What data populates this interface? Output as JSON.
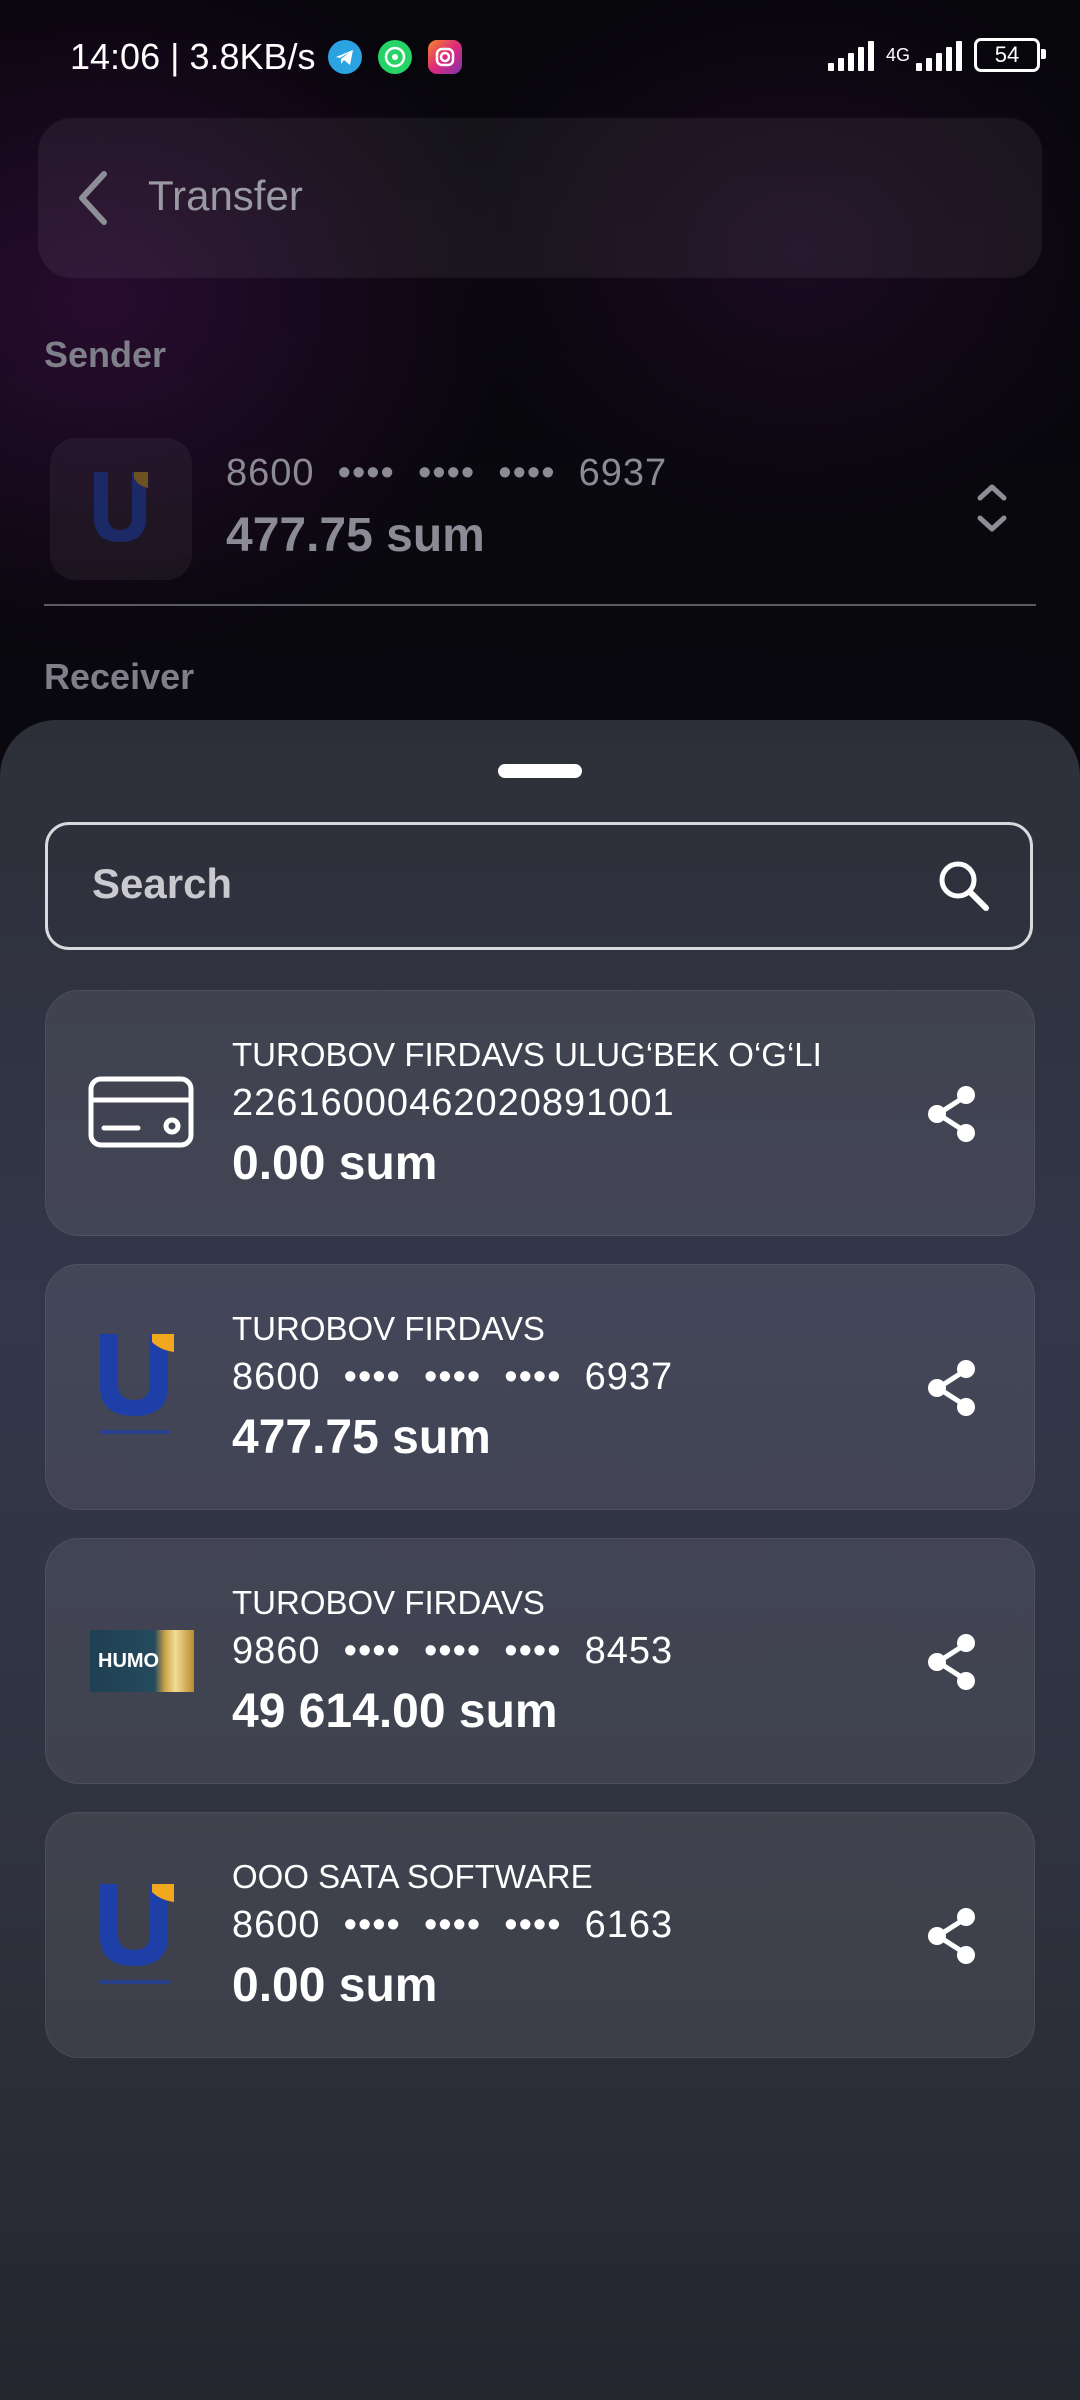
{
  "status_bar": {
    "time": "14:06 | 3.8KB/s",
    "network": "4G",
    "battery": "54"
  },
  "header": {
    "title": "Transfer"
  },
  "sender": {
    "label": "Sender",
    "card_number": "8600  ••••  ••••  ••••  6937",
    "balance": "477.75 sum"
  },
  "receiver": {
    "label": "Receiver"
  },
  "search": {
    "placeholder": "Search"
  },
  "cards": [
    {
      "name": "TUROBOV FIRDAVS ULUG‘BEK O‘G‘LI",
      "number": "22616000462020891001",
      "balance": "0.00 sum",
      "logo": "card-icon"
    },
    {
      "name": "TUROBOV FIRDAVS",
      "number": "8600  ••••  ••••  ••••  6937",
      "balance": "477.75 sum",
      "logo": "uzcard-logo"
    },
    {
      "name": "TUROBOV FIRDAVS",
      "number": "9860  ••••  ••••  ••••  8453",
      "balance": "49 614.00 sum",
      "logo": "humo-logo",
      "logo_text": "HUMO"
    },
    {
      "name": "OOO SATA SOFTWARE",
      "number": "8600  ••••  ••••  ••••  6163",
      "balance": "0.00 sum",
      "logo": "uzcard-logo"
    }
  ],
  "colors": {
    "uzcard_blue": "#1f3fa8",
    "uzcard_yellow": "#f2a81d",
    "telegram": "#2aa3e0",
    "whatsapp": "#25d366",
    "instagram": "#e1306c"
  }
}
